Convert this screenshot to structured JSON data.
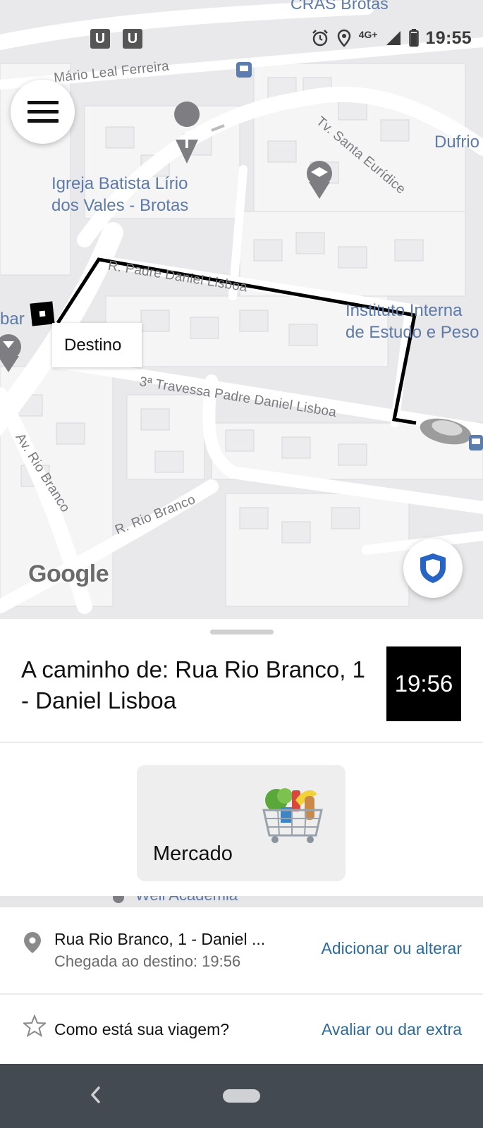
{
  "status_bar": {
    "time": "19:55",
    "network": "4G+",
    "notification_icons": [
      "uber-icon",
      "uber-icon"
    ],
    "system_icons": [
      "alarm-icon",
      "location-icon",
      "signal-icon",
      "battery-icon"
    ]
  },
  "map": {
    "street_labels": {
      "mario_leal": "Mário Leal Ferreira",
      "santa_euridice": "Tv. Santa Eurídice",
      "padre_daniel": "R. Padre Daniel Lisboa",
      "travessa": "3ª Travessa Padre Daniel Lisboa",
      "av_rio_branco": "Av. Rio Branco",
      "r_rio_branco": "R. Rio Branco",
      "cras": "CRAS Brotas",
      "bar": "bar"
    },
    "poi_labels": {
      "igreja": "Igreja Batista Lírio\ndos Vales - Brotas",
      "instituto": "Instituto Interna\nde Estudo e Peso",
      "dufrio": "Dufrio",
      "academia": "Well Academia"
    },
    "destino_label": "Destino",
    "google_logo": "Google",
    "route_color": "#000000"
  },
  "trip": {
    "title": "A caminho de: Rua Rio Branco, 1 - Daniel Lisboa",
    "eta": "19:56"
  },
  "category_card": {
    "label": "Mercado",
    "icon": "grocery-basket-icon"
  },
  "destination_row": {
    "address": "Rua Rio Branco, 1 - Daniel ...",
    "arrival": "Chegada ao destino: 19:56",
    "action": "Adicionar ou alterar",
    "icon": "location-pin-icon"
  },
  "rating_row": {
    "question": "Como está sua viagem?",
    "action": "Avaliar ou dar extra",
    "icon": "star-icon"
  },
  "colors": {
    "link": "#2c6b9a",
    "poi": "#5d7aa8",
    "shield": "#2764c4",
    "nav_bar": "#444a52"
  }
}
